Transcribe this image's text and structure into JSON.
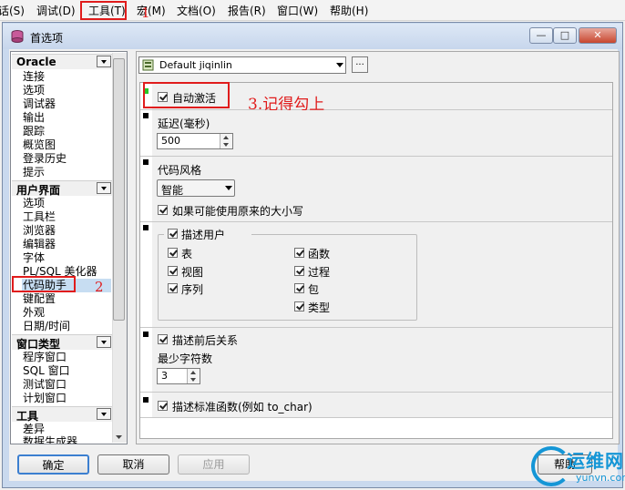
{
  "menubar": {
    "items": [
      "话(S)",
      "调试(D)",
      "工具(T)",
      "宏(M)",
      "文档(O)",
      "报告(R)",
      "窗口(W)",
      "帮助(H)"
    ]
  },
  "annotations": {
    "step1": "1",
    "step2": "2",
    "step3": "3.记得勾上",
    "color": "#e01c1c"
  },
  "window": {
    "title": "首选项",
    "minimize": "—",
    "maximize": "□",
    "close": "✕"
  },
  "left_nav": {
    "categories": [
      {
        "label": "Oracle",
        "items": [
          "连接",
          "选项",
          "调试器",
          "输出",
          "跟踪",
          "概览图",
          "登录历史",
          "提示"
        ]
      },
      {
        "label": "用户界面",
        "items": [
          "选项",
          "工具栏",
          "浏览器",
          "编辑器",
          "字体",
          "PL/SQL 美化器",
          "代码助手",
          "键配置",
          "外观",
          "日期/时间"
        ]
      },
      {
        "label": "窗口类型",
        "items": [
          "程序窗口",
          "SQL 窗口",
          "测试窗口",
          "计划窗口"
        ]
      },
      {
        "label": "工具",
        "items": [
          "差异",
          "数据生成器"
        ]
      }
    ],
    "selected": "代码助手"
  },
  "profile": {
    "value": "Default jiqinlin",
    "more": "..."
  },
  "code_assistant": {
    "auto_activate": {
      "label": "自动激活",
      "checked": true
    },
    "delay": {
      "label": "延迟(毫秒)",
      "value": "500"
    },
    "code_style": {
      "label": "代码风格",
      "value": "智能"
    },
    "keep_case": {
      "label": "如果可能使用原来的大小写",
      "checked": true
    },
    "describe_users": {
      "label": "描述用户",
      "checked": true
    },
    "object_types": [
      {
        "label": "表",
        "checked": true
      },
      {
        "label": "视图",
        "checked": true
      },
      {
        "label": "序列",
        "checked": true
      },
      {
        "label": "函数",
        "checked": true
      },
      {
        "label": "过程",
        "checked": true
      },
      {
        "label": "包",
        "checked": true
      },
      {
        "label": "类型",
        "checked": true
      }
    ],
    "describe_context": {
      "label": "描述前后关系",
      "checked": true
    },
    "min_chars": {
      "label": "最少字符数",
      "value": "3"
    },
    "describe_std_funcs": {
      "label": "描述标准函数(例如 to_char)",
      "checked": true
    }
  },
  "buttons": {
    "ok": "确定",
    "cancel": "取消",
    "apply": "应用",
    "help": "帮助"
  },
  "watermark": {
    "cn": "运维网",
    "en": "yunvn.com",
    "color": "#1596d6"
  }
}
